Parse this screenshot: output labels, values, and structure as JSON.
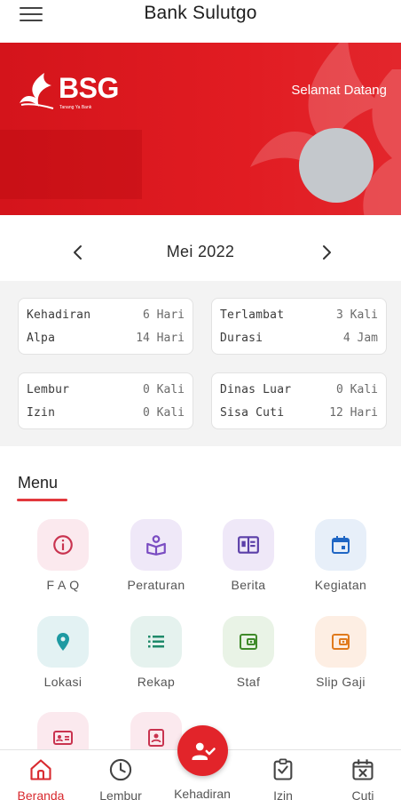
{
  "appbar": {
    "title": "Bank Sulutgo"
  },
  "banner": {
    "logo_text": "BSG",
    "logo_tagline": "Tanang Ya Bank",
    "welcome": "Selamat Datang"
  },
  "month": {
    "label": "Mei 2022"
  },
  "stats": {
    "card1": {
      "r1k": "Kehadiran",
      "r1v": "6 Hari",
      "r2k": "Alpa",
      "r2v": "14 Hari"
    },
    "card2": {
      "r1k": "Terlambat",
      "r1v": "3 Kali",
      "r2k": "Durasi",
      "r2v": "4 Jam"
    },
    "card3": {
      "r1k": "Lembur",
      "r1v": "0 Kali",
      "r2k": "Izin",
      "r2v": "0 Kali"
    },
    "card4": {
      "r1k": "Dinas Luar",
      "r1v": "0 Kali",
      "r2k": "Sisa Cuti",
      "r2v": "12 Hari"
    }
  },
  "menu": {
    "heading": "Menu",
    "items": [
      {
        "label": "F A Q"
      },
      {
        "label": "Peraturan"
      },
      {
        "label": "Berita"
      },
      {
        "label": "Kegiatan"
      },
      {
        "label": "Lokasi"
      },
      {
        "label": "Rekap"
      },
      {
        "label": "Staf"
      },
      {
        "label": "Slip Gaji"
      }
    ]
  },
  "nav": {
    "beranda": "Beranda",
    "lembur": "Lembur",
    "kehadiran": "Kehadiran",
    "izin": "Izin",
    "cuti": "Cuti"
  },
  "colors": {
    "brand_red": "#e2242a",
    "accent": "#d82a2f"
  }
}
